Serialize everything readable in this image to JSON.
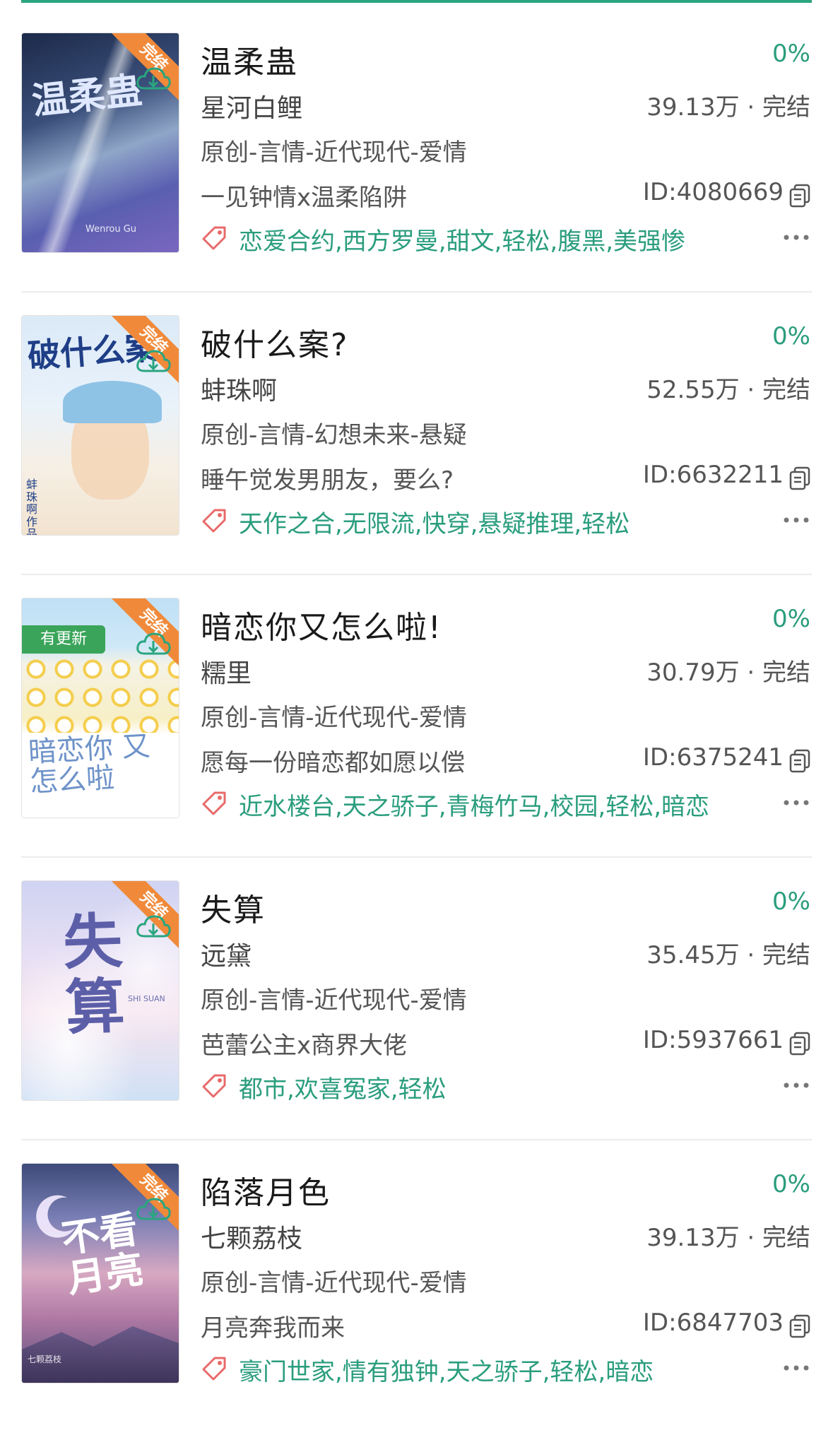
{
  "colors": {
    "accent": "#2aa57f",
    "tag_text": "#2a9d7d",
    "tag_icon": "#e86a6a",
    "ribbon": "#f08a3a",
    "update_badge": "#3aa55a"
  },
  "ribbon_label": "完结",
  "update_badge": "有更新",
  "books": [
    {
      "title": "温柔蛊",
      "progress": "0%",
      "author": "星河白鲤",
      "words": "39.13万 · 完结",
      "genre": "原创-言情-近代现代-爱情",
      "intro": "一见钟情x温柔陷阱",
      "id": "ID:4080669",
      "tags": "恋爱合约,西方罗曼,甜文,轻松,腹黑,美强惨",
      "cover_title": "温柔蛊",
      "cover_sub": "Wenrou Gu",
      "has_update": false
    },
    {
      "title": "破什么案?",
      "progress": "0%",
      "author": "蚌珠啊",
      "words": "52.55万 · 完结",
      "genre": "原创-言情-幻想未来-悬疑",
      "intro": "睡午觉发男朋友，要么?",
      "id": "ID:6632211",
      "tags": "天作之合,无限流,快穿,悬疑推理,轻松",
      "cover_title": "破什么案",
      "cover_sub": "蚌珠啊 作品",
      "has_update": false
    },
    {
      "title": "暗恋你又怎么啦!",
      "progress": "0%",
      "author": "糯里",
      "words": "30.79万 · 完结",
      "genre": "原创-言情-近代现代-爱情",
      "intro": "愿每一份暗恋都如愿以偿",
      "id": "ID:6375241",
      "tags": "近水楼台,天之骄子,青梅竹马,校园,轻松,暗恋",
      "cover_title": "暗恋你 又怎么啦",
      "cover_sub": "",
      "has_update": true
    },
    {
      "title": "失算",
      "progress": "0%",
      "author": "远黛",
      "words": "35.45万 · 完结",
      "genre": "原创-言情-近代现代-爱情",
      "intro": "芭蕾公主x商界大佬",
      "id": "ID:5937661",
      "tags": "都市,欢喜冤家,轻松",
      "cover_title": "失算",
      "cover_sub": "SHI SUAN",
      "has_update": false
    },
    {
      "title": "陷落月色",
      "progress": "0%",
      "author": "七颗荔枝",
      "words": "39.13万 · 完结",
      "genre": "原创-言情-近代现代-爱情",
      "intro": "月亮奔我而来",
      "id": "ID:6847703",
      "tags": "豪门世家,情有独钟,天之骄子,轻松,暗恋",
      "cover_title": "不看月亮",
      "cover_sub": "七颗荔枝",
      "has_update": false
    }
  ]
}
